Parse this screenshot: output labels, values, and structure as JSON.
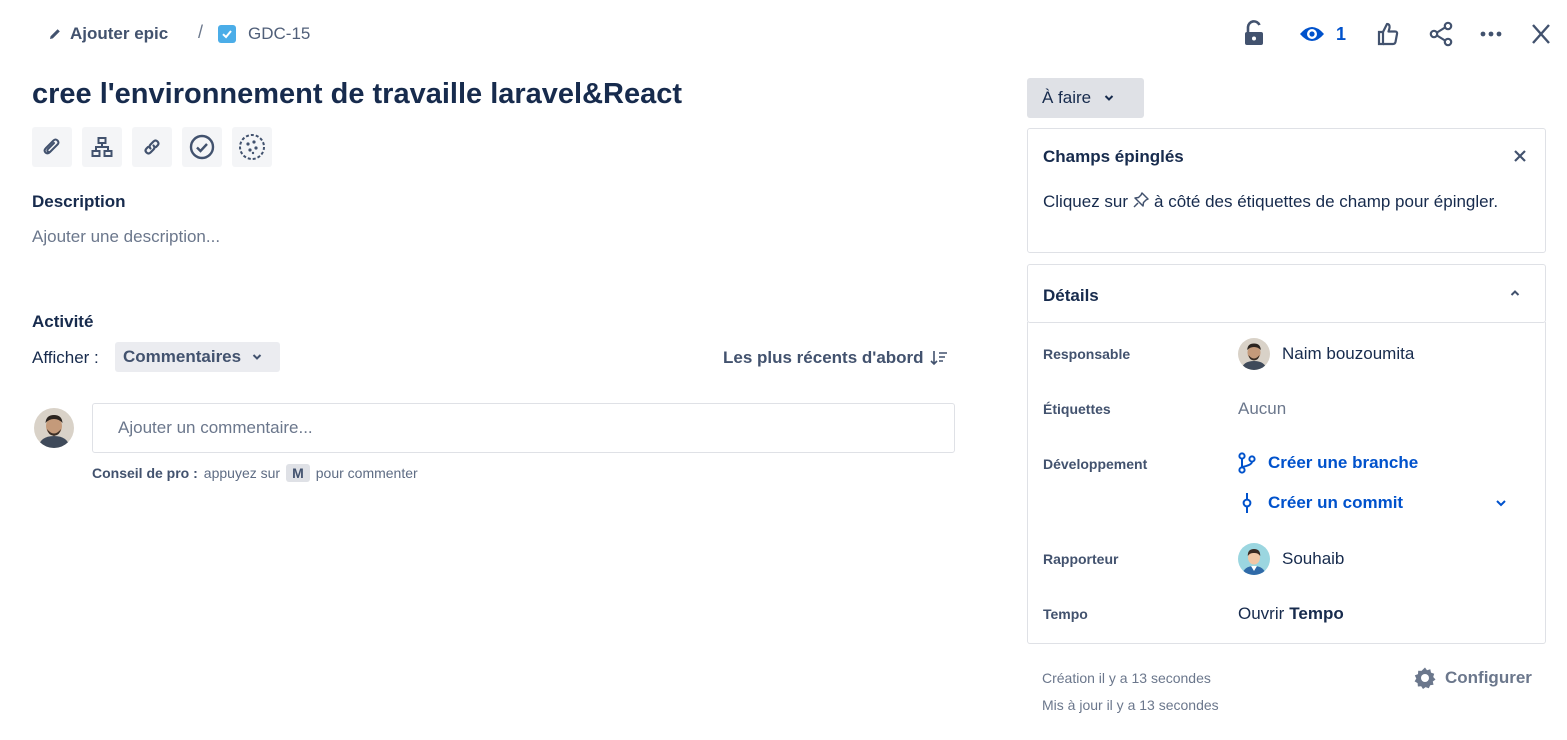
{
  "breadcrumb": {
    "epic_label": "Ajouter epic",
    "separator": "/",
    "issue_key": "GDC-15"
  },
  "header_actions": {
    "watchers_count": "1"
  },
  "issue": {
    "title": "cree l'environnement de travaille laravel&React"
  },
  "description": {
    "heading": "Description",
    "placeholder": "Ajouter une description..."
  },
  "activity": {
    "heading": "Activité",
    "show_label": "Afficher :",
    "show_value": "Commentaires",
    "sort_label": "Les plus récents d'abord",
    "comment_placeholder": "Ajouter un commentaire...",
    "pro_tip_label": "Conseil de pro :",
    "pro_tip_before": "appuyez sur",
    "pro_tip_key": "M",
    "pro_tip_after": "pour commenter"
  },
  "status": {
    "label": "À faire"
  },
  "pinned_fields": {
    "title": "Champs épinglés",
    "text_before": "Cliquez sur",
    "text_after": "à côté des étiquettes de champ pour épingler."
  },
  "details": {
    "title": "Détails",
    "assignee_label": "Responsable",
    "assignee_value": "Naim bouzoumita",
    "labels_label": "Étiquettes",
    "labels_value": "Aucun",
    "development_label": "Développement",
    "create_branch": "Créer une branche",
    "create_commit": "Créer un commit",
    "reporter_label": "Rapporteur",
    "reporter_value": "Souhaib",
    "tempo_label": "Tempo",
    "tempo_open": "Ouvrir",
    "tempo_name": "Tempo"
  },
  "footer": {
    "created": "Création il y a 13 secondes",
    "updated": "Mis à jour il y a 13 secondes",
    "configure": "Configurer"
  },
  "colors": {
    "text": "#172b4d",
    "link": "#0052cc",
    "muted": "#6b778c",
    "status_bg": "#dfe1e6",
    "issue_type": "#4bade8"
  }
}
